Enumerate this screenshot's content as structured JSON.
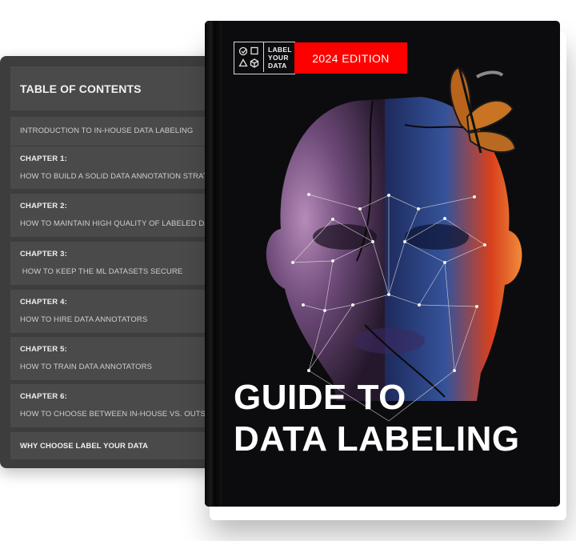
{
  "toc": {
    "heading": "TABLE OF CONTENTS",
    "items": [
      {
        "chapter": "",
        "title": "INTRODUCTION TO IN-HOUSE DATA LABELING"
      },
      {
        "chapter": "CHAPTER 1:",
        "title": "HOW TO BUILD A SOLID DATA ANNOTATION STRATEGY"
      },
      {
        "chapter": "CHAPTER 2:",
        "title": "HOW TO MAINTAIN HIGH QUALITY OF LABELED DATA"
      },
      {
        "chapter": "CHAPTER 3:",
        "title": " HOW TO KEEP THE ML DATASETS SECURE"
      },
      {
        "chapter": "CHAPTER 4:",
        "title": "HOW TO HIRE DATA ANNOTATORS"
      },
      {
        "chapter": "CHAPTER 5:",
        "title": "HOW TO TRAIN DATA ANNOTATORS"
      },
      {
        "chapter": "CHAPTER 6:",
        "title": "HOW TO CHOOSE BETWEEN IN-HOUSE VS. OUTSOURCED DATA LABELING"
      },
      {
        "chapter": "",
        "title": "WHY CHOOSE LABEL YOUR DATA"
      }
    ]
  },
  "book": {
    "logo": {
      "line1": "LABEL",
      "line2": "YOUR",
      "line3": "DATA",
      "icons": [
        "check-circle-icon",
        "square-icon",
        "triangle-icon",
        "cube-icon"
      ]
    },
    "edition_badge": "2024 EDITION",
    "title_line1": "GUIDE TO",
    "title_line2": "DATA LABELING",
    "colors": {
      "cover": "#0c0c0e",
      "badge": "#ff0000",
      "toc_panel": "#3d3d3d",
      "toc_block": "#4a4a4a"
    }
  }
}
